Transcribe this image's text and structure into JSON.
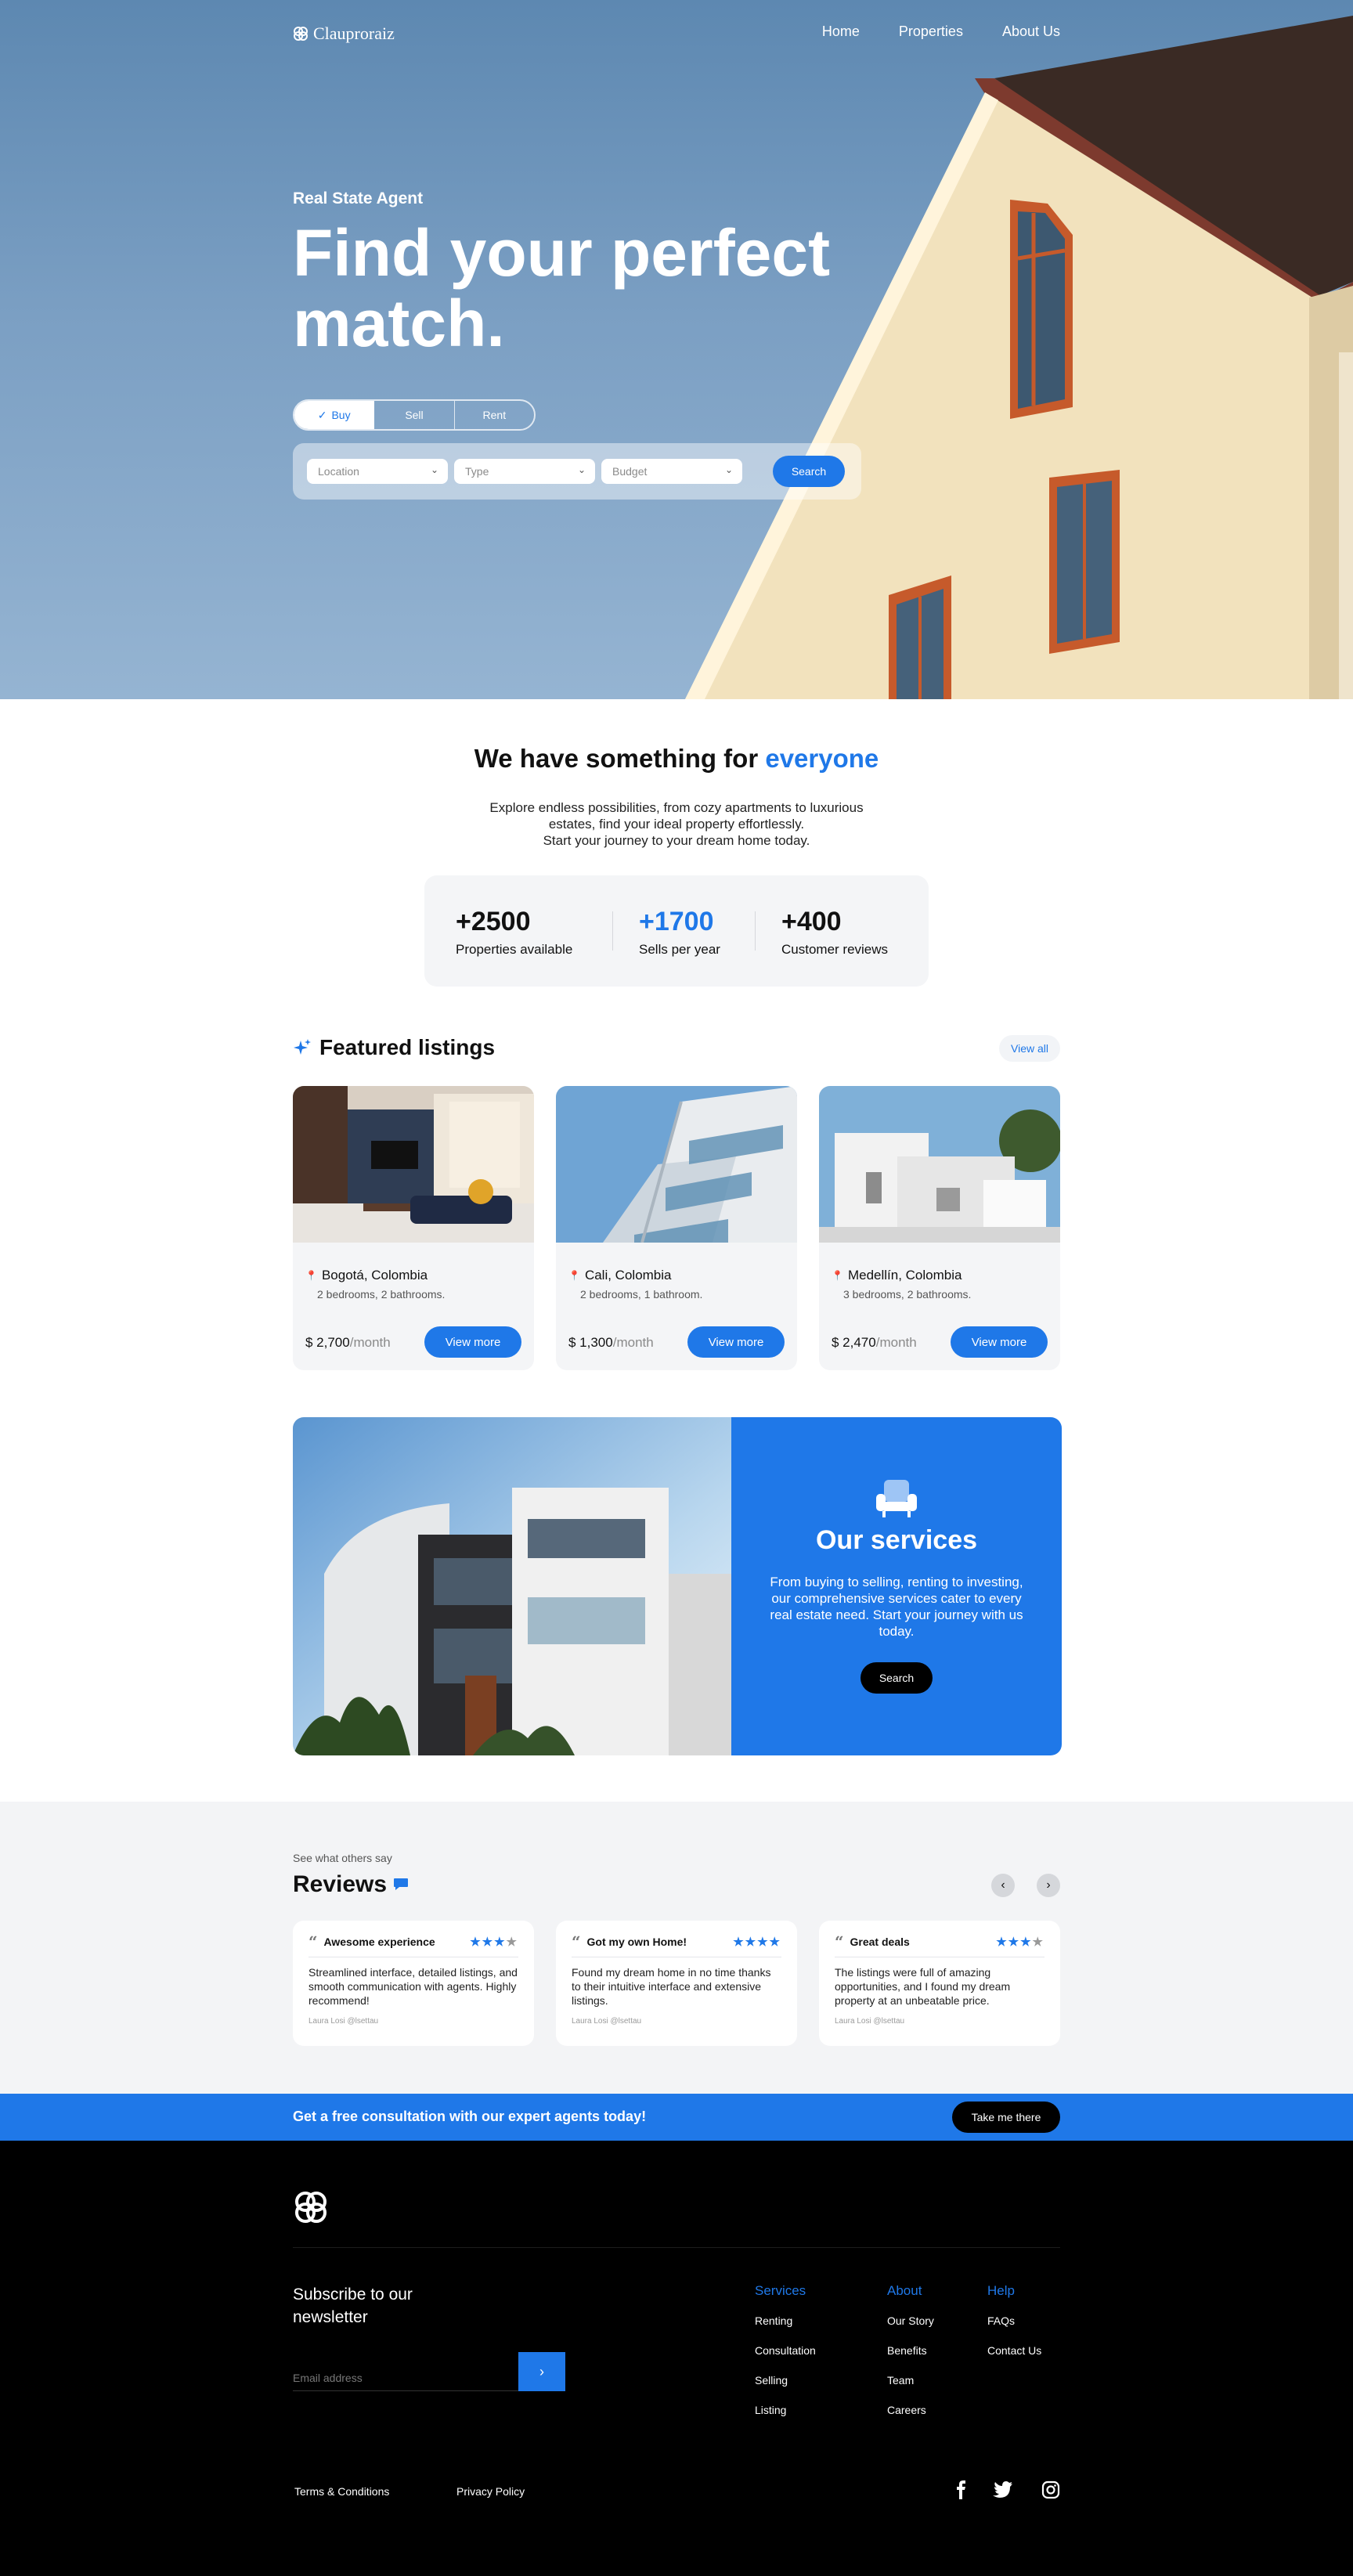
{
  "brand": {
    "name": "Clauproraiz"
  },
  "nav": {
    "items": [
      "Home",
      "Properties",
      "About Us"
    ]
  },
  "hero": {
    "eyebrow": "Real State Agent",
    "headline_line1": "Find your perfect",
    "headline_line2": "match.",
    "tabs": [
      "Buy",
      "Sell",
      "Rent"
    ],
    "active_tab": "Buy",
    "filters": {
      "location": "Location",
      "type": "Type",
      "budget": "Budget"
    },
    "search_label": "Search"
  },
  "intro": {
    "title_prefix": "We have something for",
    "title_accent": "everyone",
    "line1": "Explore endless possibilities, from cozy apartments to luxurious",
    "line2": "estates, find your ideal property effortlessly.",
    "line3": "Start your journey to your dream home today."
  },
  "stats": [
    {
      "value": "+2500",
      "label": "Properties available"
    },
    {
      "value": "+1700",
      "label": "Sells per year"
    },
    {
      "value": "+400",
      "label": "Customer reviews"
    }
  ],
  "featured": {
    "title": "Featured listings",
    "view_all": "View all",
    "listings": [
      {
        "city": "Bogotá, Colombia",
        "rooms": "2 bedrooms, 2 bathrooms.",
        "price": "$ 2,700",
        "period": "/month",
        "cta": "View more"
      },
      {
        "city": "Cali, Colombia",
        "rooms": "2 bedrooms, 1 bathroom.",
        "price": "$ 1,300",
        "period": "/month",
        "cta": "View more"
      },
      {
        "city": "Medellín, Colombia",
        "rooms": "3 bedrooms, 2 bathrooms.",
        "price": "$ 2,470",
        "period": "/month",
        "cta": "View more"
      }
    ]
  },
  "services": {
    "title": "Our services",
    "text": "From buying to selling, renting to investing, our comprehensive services cater to every real estate need. Start your journey with us today.",
    "button": "Search"
  },
  "reviews": {
    "eyebrow": "See what others say",
    "title": "Reviews",
    "items": [
      {
        "title": "Awesome experience",
        "stars": 3,
        "max": 4,
        "text": "Streamlined interface, detailed listings, and smooth communication with agents. Highly recommend!",
        "author": "Laura Losi @lsettau"
      },
      {
        "title": "Got my own Home!",
        "stars": 4,
        "max": 4,
        "text": "Found my dream home in no time thanks to their intuitive interface and extensive listings.",
        "author": "Laura Losi @lsettau"
      },
      {
        "title": "Great deals",
        "stars": 3,
        "max": 4,
        "text": "The listings were full of amazing opportunities, and I found my dream property at an unbeatable price.",
        "author": "Laura Losi @lsettau"
      }
    ]
  },
  "cta": {
    "text": "Get a free consultation with our expert agents today!",
    "button": "Take me there"
  },
  "footer": {
    "subscribe_line1": "Subscribe to our",
    "subscribe_line2": "newsletter",
    "email_placeholder": "Email address",
    "columns": [
      {
        "heading": "Services",
        "items": [
          "Renting",
          "Consultation",
          "Selling",
          "Listing"
        ]
      },
      {
        "heading": "About",
        "items": [
          "Our Story",
          "Benefits",
          "Team",
          "Careers"
        ]
      },
      {
        "heading": "Help",
        "items": [
          "FAQs",
          "Contact Us"
        ]
      }
    ],
    "terms": "Terms & Conditions",
    "privacy": "Privacy Policy",
    "social": [
      "facebook-icon",
      "twitter-icon",
      "instagram-icon"
    ]
  },
  "colors": {
    "accent": "#1f78e8",
    "dark": "#000000",
    "light_bg": "#f4f5f7"
  }
}
